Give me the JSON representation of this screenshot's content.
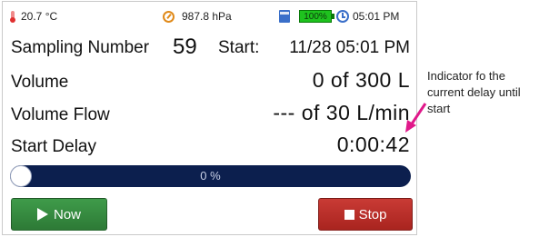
{
  "status_bar": {
    "temperature": "20.7 °C",
    "pressure": "987.8 hPa",
    "battery": "100%",
    "time": "05:01 PM"
  },
  "rows": {
    "sampling_label": "Sampling Number",
    "sampling_number": "59",
    "start_label": "Start:",
    "start_value": "11/28 05:01 PM",
    "volume_label": "Volume",
    "volume_value": "0 of 300 L",
    "flow_label": "Volume Flow",
    "flow_value": "--- of 30 L/min",
    "delay_label": "Start Delay",
    "delay_value": "0:00:42"
  },
  "progress": {
    "text": "0 %",
    "value_percent": 0
  },
  "buttons": {
    "now": "Now",
    "stop": "Stop"
  },
  "annotation": {
    "text": "Indicator fo the current delay until start"
  },
  "colors": {
    "progress_bg": "#0c1f4e",
    "now_button": "#3f9b4a",
    "stop_button": "#c93b35",
    "arrow": "#e0188a"
  },
  "icons": {
    "temperature": "thermometer-icon",
    "pressure": "gauge-icon",
    "storage": "sd-card-icon",
    "battery": "battery-icon",
    "time": "clock-icon"
  }
}
